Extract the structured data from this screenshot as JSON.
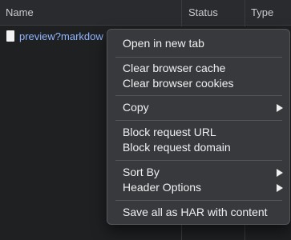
{
  "network_panel": {
    "columns": {
      "name": "Name",
      "status": "Status",
      "type": "Type"
    },
    "rows": [
      {
        "name": "preview?markdow"
      }
    ]
  },
  "context_menu": {
    "open_in_new_tab": "Open in new tab",
    "clear_browser_cache": "Clear browser cache",
    "clear_browser_cookies": "Clear browser cookies",
    "copy": "Copy",
    "block_request_url": "Block request URL",
    "block_request_domain": "Block request domain",
    "sort_by": "Sort By",
    "header_options": "Header Options",
    "save_all_as_har": "Save all as HAR with content"
  }
}
